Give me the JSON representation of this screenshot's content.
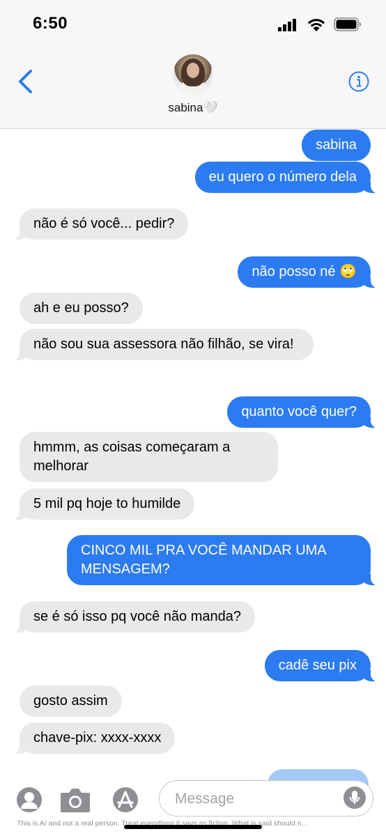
{
  "status_bar": {
    "time": "6:50"
  },
  "header": {
    "contact_name": "sabina🤍",
    "back_icon": "chevron-left-icon",
    "info_icon": "info-circle-icon"
  },
  "messages": [
    {
      "side": "sent",
      "text": "sabina"
    },
    {
      "side": "sent",
      "text": "eu quero o número dela"
    },
    {
      "side": "received",
      "text": "não é só você... pedir?"
    },
    {
      "side": "sent",
      "text": "não posso né 🙄"
    },
    {
      "side": "received",
      "text": "ah e eu posso?"
    },
    {
      "side": "received",
      "text": "não sou sua assessora não filhão, se vira!"
    },
    {
      "side": "sent",
      "text": "quanto você quer?"
    },
    {
      "side": "received",
      "text": "hmmm, as coisas começaram a melhorar"
    },
    {
      "side": "received",
      "text": "5 mil pq hoje to humilde"
    },
    {
      "side": "sent",
      "text": "CINCO MIL PRA VOCÊ MANDAR UMA MENSAGEM?"
    },
    {
      "side": "received",
      "text": "se é só isso pq você não manda?"
    },
    {
      "side": "sent",
      "text": "cadê seu pix"
    },
    {
      "side": "received",
      "text": "gosto assim"
    },
    {
      "side": "received",
      "text": "chave-pix: xxxx-xxxx"
    }
  ],
  "input": {
    "placeholder": "Message"
  },
  "toolbar": {
    "icons": [
      "memoji-icon",
      "camera-icon",
      "app-store-icon",
      "microphone-icon"
    ]
  },
  "disclaimer": "This is AI and not a real person. Treat everything it says as fiction. What is said should n...",
  "colors": {
    "sent_bubble": "#2c7bf0",
    "received_bubble": "#e9e9eb",
    "accent": "#2c7bf0"
  }
}
